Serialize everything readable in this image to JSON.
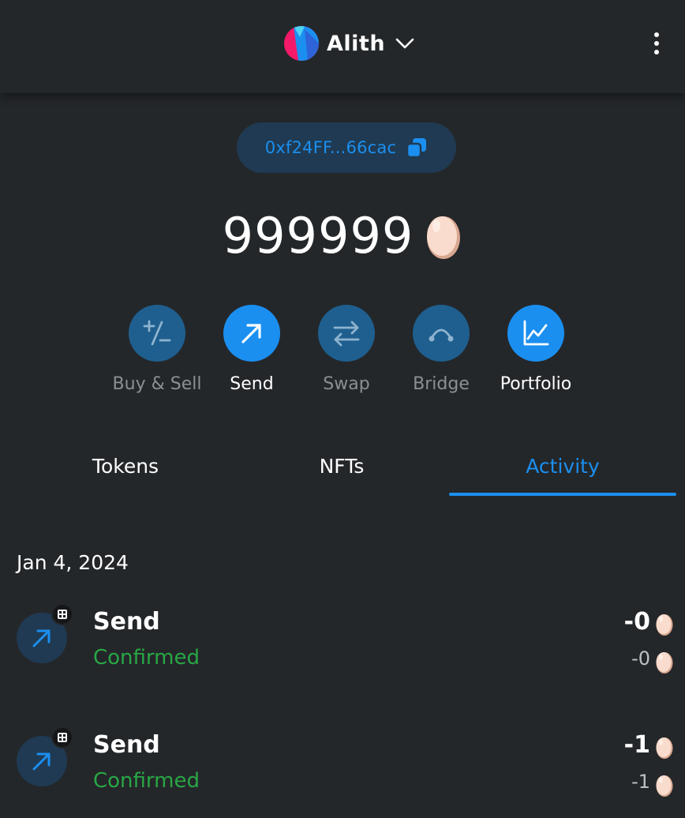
{
  "header": {
    "account_name": "Alith",
    "avatar_icon": "jazzicon-avatar",
    "dropdown_icon": "chevron-down-icon",
    "menu_icon": "kebab-menu-icon"
  },
  "address": {
    "short": "0xf24FF...66cac",
    "copy_icon": "copy-icon"
  },
  "balance": {
    "amount": "999999",
    "token_icon": "egg-icon"
  },
  "actions": [
    {
      "label": "Buy & Sell",
      "icon": "plus-minus-icon",
      "enabled": false
    },
    {
      "label": "Send",
      "icon": "arrow-up-right-icon",
      "enabled": true
    },
    {
      "label": "Swap",
      "icon": "swap-arrows-icon",
      "enabled": false
    },
    {
      "label": "Bridge",
      "icon": "bridge-icon",
      "enabled": false
    },
    {
      "label": "Portfolio",
      "icon": "chart-icon",
      "enabled": true
    }
  ],
  "tabs": [
    {
      "label": "Tokens",
      "active": false
    },
    {
      "label": "NFTs",
      "active": false
    },
    {
      "label": "Activity",
      "active": true
    }
  ],
  "activity": {
    "date": "Jan 4, 2024",
    "items": [
      {
        "title": "Send",
        "status": "Confirmed",
        "amount": "-0",
        "fiat": "-0"
      },
      {
        "title": "Send",
        "status": "Confirmed",
        "amount": "-1",
        "fiat": "-1"
      }
    ]
  },
  "colors": {
    "accent": "#1b8ff0",
    "background": "#24272a",
    "success": "#28a745",
    "muted": "#8b8f93"
  }
}
